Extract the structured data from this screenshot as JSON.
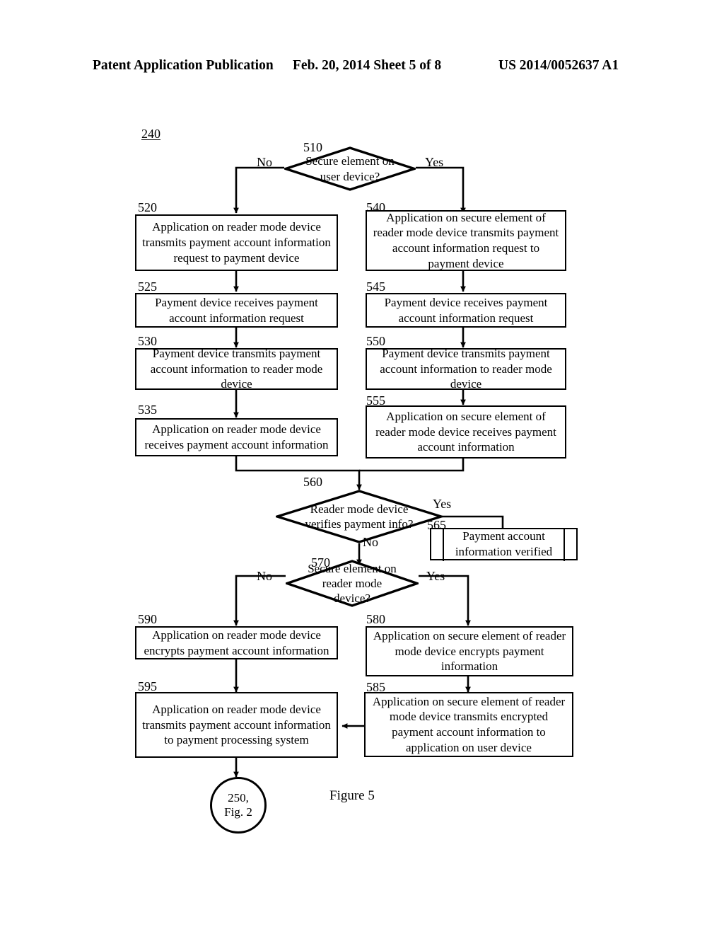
{
  "header": {
    "publication": "Patent Application Publication",
    "date_sheet": "Feb. 20, 2014  Sheet 5 of 8",
    "patent_number": "US 2014/0052637 A1"
  },
  "figure": {
    "caption": "Figure 5",
    "diagram_ref": "240",
    "nodes": [
      {
        "id": "510",
        "ref": "510",
        "shape": "decision",
        "text": "Secure element on user device?"
      },
      {
        "id": "520",
        "ref": "520",
        "shape": "process",
        "text": "Application on reader mode device transmits payment account information request to payment device"
      },
      {
        "id": "525",
        "ref": "525",
        "shape": "process",
        "text": "Payment device receives payment account information request"
      },
      {
        "id": "530",
        "ref": "530",
        "shape": "process",
        "text": "Payment device transmits payment account information to reader mode device"
      },
      {
        "id": "535",
        "ref": "535",
        "shape": "process",
        "text": "Application on reader mode device receives payment account information"
      },
      {
        "id": "540",
        "ref": "540",
        "shape": "process",
        "text": "Application on secure element of reader mode device transmits payment account information request to payment device"
      },
      {
        "id": "545",
        "ref": "545",
        "shape": "process",
        "text": "Payment device receives payment account information request"
      },
      {
        "id": "550",
        "ref": "550",
        "shape": "process",
        "text": "Payment device transmits payment account information to reader mode device"
      },
      {
        "id": "555",
        "ref": "555",
        "shape": "process",
        "text": "Application on secure element of reader mode device receives payment account information"
      },
      {
        "id": "560",
        "ref": "560",
        "shape": "decision",
        "text": "Reader mode device verifies payment info?"
      },
      {
        "id": "565",
        "ref": "565",
        "shape": "predefined-process",
        "text": "Payment account information verified"
      },
      {
        "id": "570",
        "ref": "570",
        "shape": "decision",
        "text": "Secure element on reader mode device?"
      },
      {
        "id": "580",
        "ref": "580",
        "shape": "process",
        "text": "Application on secure element of reader mode device encrypts payment information"
      },
      {
        "id": "585",
        "ref": "585",
        "shape": "process",
        "text": "Application on secure element of reader mode device transmits encrypted payment account information to application on user device"
      },
      {
        "id": "590",
        "ref": "590",
        "shape": "process",
        "text": "Application on reader mode device encrypts payment account information"
      },
      {
        "id": "595",
        "ref": "595",
        "shape": "process",
        "text": "Application on reader mode device transmits payment account information to payment processing system"
      },
      {
        "id": "250",
        "ref": "",
        "shape": "connector",
        "text": "250, Fig. 2"
      }
    ],
    "terminator": {
      "line1": "250,",
      "line2": "Fig. 2"
    },
    "edge_labels": {
      "d510_no": "No",
      "d510_yes": "Yes",
      "d560_yes": "Yes",
      "d560_no": "No",
      "d570_no": "No",
      "d570_yes": "Yes"
    }
  }
}
